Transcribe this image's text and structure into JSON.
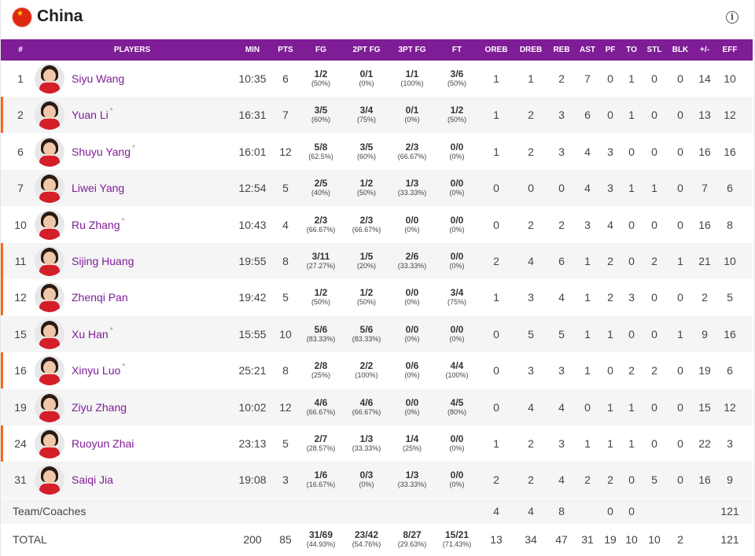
{
  "team": {
    "name": "China"
  },
  "colors": {
    "header_bg": "#7f1d97",
    "player_link": "#7f1d97",
    "starter_marker": "#f26a21"
  },
  "columns": [
    "#",
    "PLAYERS",
    "MIN",
    "PTS",
    "FG",
    "2PT FG",
    "3PT FG",
    "FT",
    "OREB",
    "DREB",
    "REB",
    "AST",
    "PF",
    "TO",
    "STL",
    "BLK",
    "+/-",
    "EFF"
  ],
  "players": [
    {
      "num": "1",
      "name": "Siyu Wang",
      "star": "",
      "marked": false,
      "min": "10:35",
      "pts": "6",
      "fg": "1/2",
      "fg_pct": "(50%)",
      "p2": "0/1",
      "p2_pct": "(0%)",
      "p3": "1/1",
      "p3_pct": "(100%)",
      "ft": "3/6",
      "ft_pct": "(50%)",
      "oreb": "1",
      "dreb": "1",
      "reb": "2",
      "ast": "7",
      "pf": "0",
      "to": "1",
      "stl": "0",
      "blk": "0",
      "pm": "14",
      "eff": "10"
    },
    {
      "num": "2",
      "name": "Yuan Li",
      "star": "*",
      "marked": true,
      "min": "16:31",
      "pts": "7",
      "fg": "3/5",
      "fg_pct": "(60%)",
      "p2": "3/4",
      "p2_pct": "(75%)",
      "p3": "0/1",
      "p3_pct": "(0%)",
      "ft": "1/2",
      "ft_pct": "(50%)",
      "oreb": "1",
      "dreb": "2",
      "reb": "3",
      "ast": "6",
      "pf": "0",
      "to": "1",
      "stl": "0",
      "blk": "0",
      "pm": "13",
      "eff": "12"
    },
    {
      "num": "6",
      "name": "Shuyu Yang",
      "star": "*",
      "marked": false,
      "min": "16:01",
      "pts": "12",
      "fg": "5/8",
      "fg_pct": "(62.5%)",
      "p2": "3/5",
      "p2_pct": "(60%)",
      "p3": "2/3",
      "p3_pct": "(66.67%)",
      "ft": "0/0",
      "ft_pct": "(0%)",
      "oreb": "1",
      "dreb": "2",
      "reb": "3",
      "ast": "4",
      "pf": "3",
      "to": "0",
      "stl": "0",
      "blk": "0",
      "pm": "16",
      "eff": "16"
    },
    {
      "num": "7",
      "name": "Liwei Yang",
      "star": "",
      "marked": false,
      "min": "12:54",
      "pts": "5",
      "fg": "2/5",
      "fg_pct": "(40%)",
      "p2": "1/2",
      "p2_pct": "(50%)",
      "p3": "1/3",
      "p3_pct": "(33.33%)",
      "ft": "0/0",
      "ft_pct": "(0%)",
      "oreb": "0",
      "dreb": "0",
      "reb": "0",
      "ast": "4",
      "pf": "3",
      "to": "1",
      "stl": "1",
      "blk": "0",
      "pm": "7",
      "eff": "6"
    },
    {
      "num": "10",
      "name": "Ru Zhang",
      "star": "*",
      "marked": false,
      "min": "10:43",
      "pts": "4",
      "fg": "2/3",
      "fg_pct": "(66.67%)",
      "p2": "2/3",
      "p2_pct": "(66.67%)",
      "p3": "0/0",
      "p3_pct": "(0%)",
      "ft": "0/0",
      "ft_pct": "(0%)",
      "oreb": "0",
      "dreb": "2",
      "reb": "2",
      "ast": "3",
      "pf": "4",
      "to": "0",
      "stl": "0",
      "blk": "0",
      "pm": "16",
      "eff": "8"
    },
    {
      "num": "11",
      "name": "Sijing Huang",
      "star": "",
      "marked": true,
      "min": "19:55",
      "pts": "8",
      "fg": "3/11",
      "fg_pct": "(27.27%)",
      "p2": "1/5",
      "p2_pct": "(20%)",
      "p3": "2/6",
      "p3_pct": "(33.33%)",
      "ft": "0/0",
      "ft_pct": "(0%)",
      "oreb": "2",
      "dreb": "4",
      "reb": "6",
      "ast": "1",
      "pf": "2",
      "to": "0",
      "stl": "2",
      "blk": "1",
      "pm": "21",
      "eff": "10"
    },
    {
      "num": "12",
      "name": "Zhenqi Pan",
      "star": "",
      "marked": true,
      "min": "19:42",
      "pts": "5",
      "fg": "1/2",
      "fg_pct": "(50%)",
      "p2": "1/2",
      "p2_pct": "(50%)",
      "p3": "0/0",
      "p3_pct": "(0%)",
      "ft": "3/4",
      "ft_pct": "(75%)",
      "oreb": "1",
      "dreb": "3",
      "reb": "4",
      "ast": "1",
      "pf": "2",
      "to": "3",
      "stl": "0",
      "blk": "0",
      "pm": "2",
      "eff": "5"
    },
    {
      "num": "15",
      "name": "Xu Han",
      "star": "*",
      "marked": false,
      "min": "15:55",
      "pts": "10",
      "fg": "5/6",
      "fg_pct": "(83.33%)",
      "p2": "5/6",
      "p2_pct": "(83.33%)",
      "p3": "0/0",
      "p3_pct": "(0%)",
      "ft": "0/0",
      "ft_pct": "(0%)",
      "oreb": "0",
      "dreb": "5",
      "reb": "5",
      "ast": "1",
      "pf": "1",
      "to": "0",
      "stl": "0",
      "blk": "1",
      "pm": "9",
      "eff": "16"
    },
    {
      "num": "16",
      "name": "Xinyu Luo",
      "star": "*",
      "marked": true,
      "min": "25:21",
      "pts": "8",
      "fg": "2/8",
      "fg_pct": "(25%)",
      "p2": "2/2",
      "p2_pct": "(100%)",
      "p3": "0/6",
      "p3_pct": "(0%)",
      "ft": "4/4",
      "ft_pct": "(100%)",
      "oreb": "0",
      "dreb": "3",
      "reb": "3",
      "ast": "1",
      "pf": "0",
      "to": "2",
      "stl": "2",
      "blk": "0",
      "pm": "19",
      "eff": "6"
    },
    {
      "num": "19",
      "name": "Ziyu Zhang",
      "star": "",
      "marked": false,
      "min": "10:02",
      "pts": "12",
      "fg": "4/6",
      "fg_pct": "(66.67%)",
      "p2": "4/6",
      "p2_pct": "(66.67%)",
      "p3": "0/0",
      "p3_pct": "(0%)",
      "ft": "4/5",
      "ft_pct": "(80%)",
      "oreb": "0",
      "dreb": "4",
      "reb": "4",
      "ast": "0",
      "pf": "1",
      "to": "1",
      "stl": "0",
      "blk": "0",
      "pm": "15",
      "eff": "12"
    },
    {
      "num": "24",
      "name": "Ruoyun Zhai",
      "star": "",
      "marked": true,
      "min": "23:13",
      "pts": "5",
      "fg": "2/7",
      "fg_pct": "(28.57%)",
      "p2": "1/3",
      "p2_pct": "(33.33%)",
      "p3": "1/4",
      "p3_pct": "(25%)",
      "ft": "0/0",
      "ft_pct": "(0%)",
      "oreb": "1",
      "dreb": "2",
      "reb": "3",
      "ast": "1",
      "pf": "1",
      "to": "1",
      "stl": "0",
      "blk": "0",
      "pm": "22",
      "eff": "3"
    },
    {
      "num": "31",
      "name": "Saiqi Jia",
      "star": "",
      "marked": false,
      "min": "19:08",
      "pts": "3",
      "fg": "1/6",
      "fg_pct": "(16.67%)",
      "p2": "0/3",
      "p2_pct": "(0%)",
      "p3": "1/3",
      "p3_pct": "(33.33%)",
      "ft": "0/0",
      "ft_pct": "(0%)",
      "oreb": "2",
      "dreb": "2",
      "reb": "4",
      "ast": "2",
      "pf": "2",
      "to": "0",
      "stl": "5",
      "blk": "0",
      "pm": "16",
      "eff": "9"
    }
  ],
  "team_row": {
    "label": "Team/Coaches",
    "oreb": "4",
    "dreb": "4",
    "reb": "8",
    "pf": "0",
    "to": "0",
    "eff": "121"
  },
  "total_row": {
    "label": "TOTAL",
    "min": "200",
    "pts": "85",
    "fg": "31/69",
    "fg_pct": "(44.93%)",
    "p2": "23/42",
    "p2_pct": "(54.76%)",
    "p3": "8/27",
    "p3_pct": "(29.63%)",
    "ft": "15/21",
    "ft_pct": "(71.43%)",
    "oreb": "13",
    "dreb": "34",
    "reb": "47",
    "ast": "31",
    "pf": "19",
    "to": "10",
    "stl": "10",
    "blk": "2",
    "eff": "121"
  }
}
